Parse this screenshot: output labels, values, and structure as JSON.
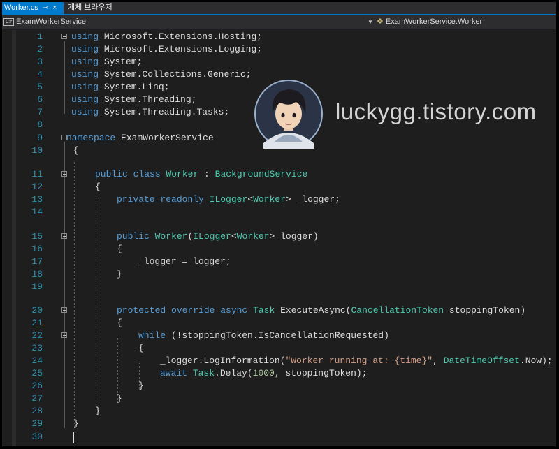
{
  "tabs": {
    "active": {
      "label": "Worker.cs",
      "pin": "⊸",
      "close": "×"
    },
    "inactive": {
      "label": "개체 브라우저"
    }
  },
  "navbar": {
    "project_badge": "C#",
    "project": "ExamWorkerService",
    "member": "ExamWorkerService.Worker"
  },
  "watermark": {
    "text": "luckygg.tistory.com"
  },
  "colors": {
    "accent": "#007acc",
    "keyword": "#569cd6",
    "type": "#4ec9b0",
    "string": "#d69d85",
    "number": "#b5cea8",
    "line_number": "#2b91af",
    "text": "#dcdcdc"
  },
  "code": {
    "line_numbers": [
      "1",
      "2",
      "3",
      "4",
      "5",
      "6",
      "7",
      "8",
      "9",
      "10",
      "11",
      "12",
      "13",
      "14",
      "15",
      "16",
      "17",
      "18",
      "19",
      "20",
      "21",
      "22",
      "23",
      "24",
      "25",
      "26",
      "27",
      "28",
      "29",
      "30"
    ],
    "l1_kw": "using",
    "l1_rest": " Microsoft.Extensions.Hosting;",
    "l2_kw": "using",
    "l2_rest": " Microsoft.Extensions.Logging;",
    "l3_kw": "using",
    "l3_rest": " System;",
    "l4_kw": "using",
    "l4_rest": " System.Collections.Generic;",
    "l5_kw": "using",
    "l5_rest": " System.Linq;",
    "l6_kw": "using",
    "l6_rest": " System.Threading;",
    "l7_kw": "using",
    "l7_rest": " System.Threading.Tasks;",
    "l9_kw": "namespace",
    "l9_rest": " ExamWorkerService",
    "l10": "{",
    "l11_kw": "public class",
    "l11_cls": "Worker",
    "l11_colon": " : ",
    "l11_base": "BackgroundService",
    "l12": "{",
    "l13_kw": "private readonly",
    "l13_t1": "ILogger",
    "l13_lt": "<",
    "l13_t2": "Worker",
    "l13_rest": "> _logger;",
    "l15_kw": "public",
    "l15_cls": "Worker",
    "l15_p": "(",
    "l15_t1": "ILogger",
    "l15_lt": "<",
    "l15_t2": "Worker",
    "l15_rest": "> logger)",
    "l16": "{",
    "l17": "_logger = logger;",
    "l18": "}",
    "l20_kw": "protected override async",
    "l20_t": "Task",
    "l20_m": " ExecuteAsync(",
    "l20_t2": "CancellationToken",
    "l20_rest": " stoppingToken)",
    "l21": "{",
    "l22_kw": "while",
    "l22_rest": " (!stoppingToken.IsCancellationRequested)",
    "l23": "{",
    "l24_a": "_logger.LogInformation(",
    "l24_s": "\"Worker running at: {time}\"",
    "l24_b": ", ",
    "l24_t": "DateTimeOffset",
    "l24_c": ".Now);",
    "l25_kw": "await",
    "l25_t": "Task",
    "l25_a": ".Delay(",
    "l25_n": "1000",
    "l25_b": ", stoppingToken);",
    "l26": "}",
    "l27": "}",
    "l28": "}",
    "l29": "}"
  }
}
